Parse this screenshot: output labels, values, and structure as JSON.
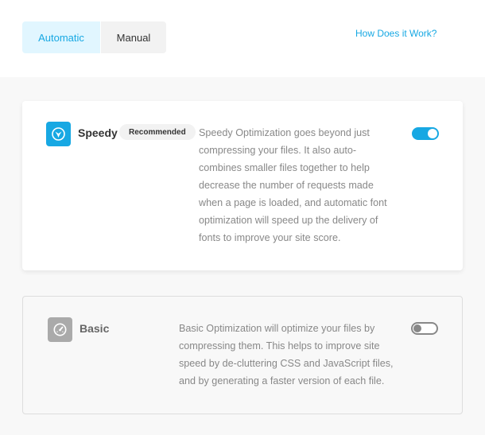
{
  "tabs": {
    "automatic_label": "Automatic",
    "manual_label": "Manual"
  },
  "help_link": "How Does it Work?",
  "speedy": {
    "title": "Speedy",
    "badge": "Recommended",
    "description": "Speedy Optimization goes beyond just compressing your files. It also auto-combines smaller files together to help decrease the number of requests made when a page is loaded, and automatic font optimization will speed up the delivery of fonts to improve your site score.",
    "enabled": true,
    "icon": "speedy-bird-icon"
  },
  "basic": {
    "title": "Basic",
    "description": "Basic Optimization will optimize your files by compressing them. This helps to improve site speed by de-cluttering CSS and JavaScript files, and by generating a faster version of each file.",
    "enabled": false,
    "icon": "gauge-icon"
  },
  "colors": {
    "accent": "#17a8e3",
    "accent_light": "#e1f6ff",
    "muted_icon": "#aaaaaa"
  }
}
